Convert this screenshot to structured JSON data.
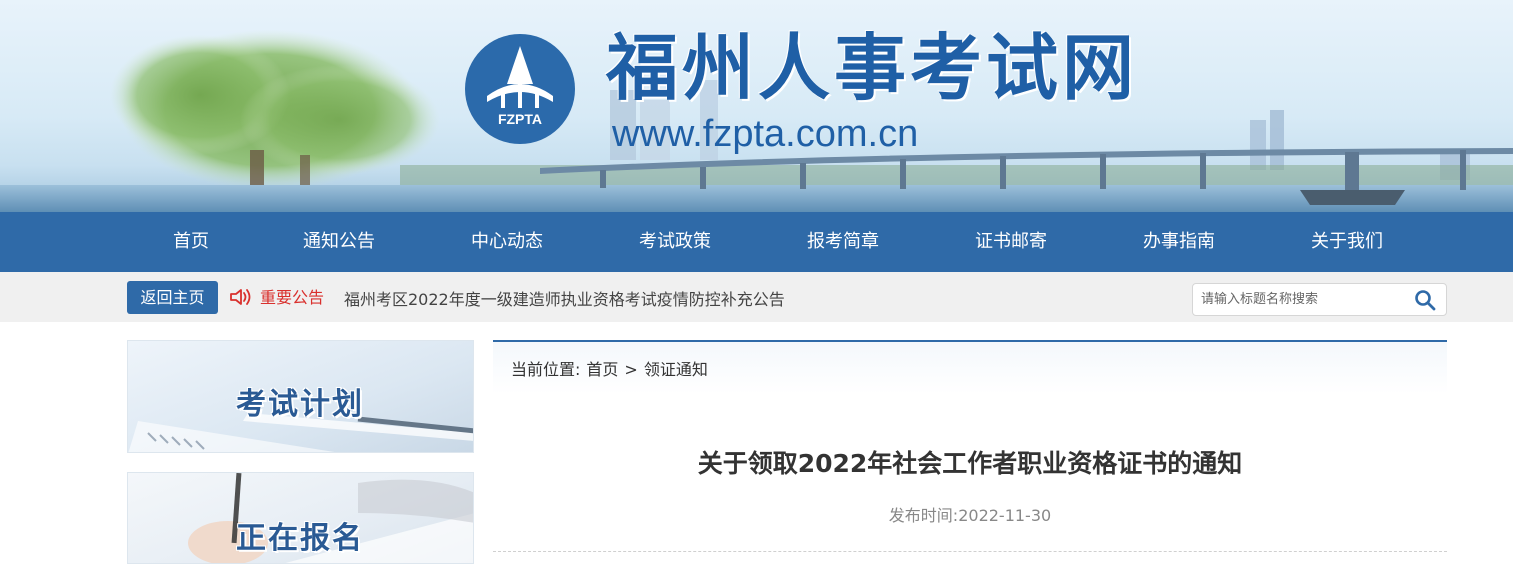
{
  "header": {
    "logo_text": "FZPTA",
    "site_title": "福州人事考试网",
    "site_url": "www.fzpta.com.cn"
  },
  "nav": {
    "items": [
      "首页",
      "通知公告",
      "中心动态",
      "考试政策",
      "报考简章",
      "证书邮寄",
      "办事指南",
      "关于我们"
    ]
  },
  "notice_bar": {
    "home_button": "返回主页",
    "label": "重要公告",
    "text": "福州考区2022年度一级建造师执业资格考试疫情防控补充公告",
    "search_placeholder": "请输入标题名称搜索"
  },
  "sidebar": {
    "cards": [
      {
        "title": "考试计划"
      },
      {
        "title": "正在报名"
      }
    ]
  },
  "breadcrumb": {
    "prefix": "当前位置:",
    "home": "首页",
    "separator": ">",
    "current": "领证通知"
  },
  "article": {
    "title": "关于领取2022年社会工作者职业资格证书的通知",
    "date_label": "发布时间:",
    "date": "2022-11-30"
  },
  "colors": {
    "primary": "#2f6aa8",
    "notice_red": "#d9302d",
    "title_blue": "#1f5fa6"
  }
}
